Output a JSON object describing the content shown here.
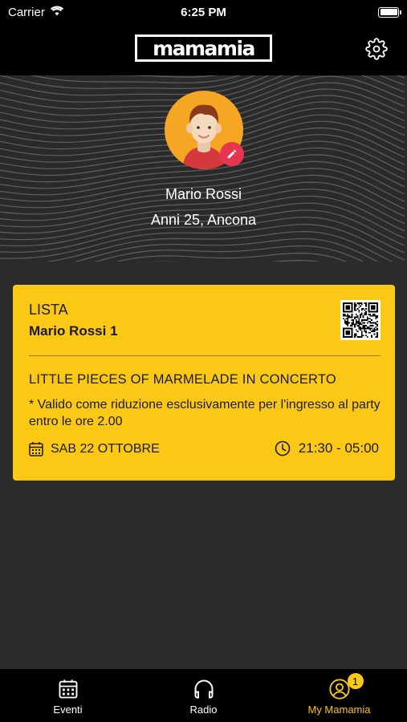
{
  "status_bar": {
    "carrier": "Carrier",
    "time": "6:25 PM"
  },
  "header": {
    "logo_text": "mamamia",
    "settings_icon": "gear-icon"
  },
  "profile": {
    "name": "Mario Rossi",
    "info": "Anni 25, Ancona",
    "avatar_icon": "person-avatar",
    "edit_icon": "pencil-icon"
  },
  "ticket": {
    "type": "LISTA",
    "holder": "Mario Rossi 1",
    "event_title": "LITTLE PIECES OF MARMELADE IN CONCERTO",
    "note": "* Valido come riduzione esclusivamente per l'ingresso al party entro le ore 2.00",
    "date": "SAB 22 OTTOBRE",
    "time": "21:30 - 05:00",
    "qr_icon": "qr-code"
  },
  "tabs": [
    {
      "label": "Eventi",
      "icon": "calendar-icon",
      "active": false
    },
    {
      "label": "Radio",
      "icon": "headphones-icon",
      "active": false
    },
    {
      "label": "My Mamamia",
      "icon": "user-circle-icon",
      "active": true,
      "badge": "1"
    }
  ],
  "colors": {
    "accent": "#fcc816",
    "edit": "#e8344e",
    "avatar_bg": "#f5a623"
  }
}
